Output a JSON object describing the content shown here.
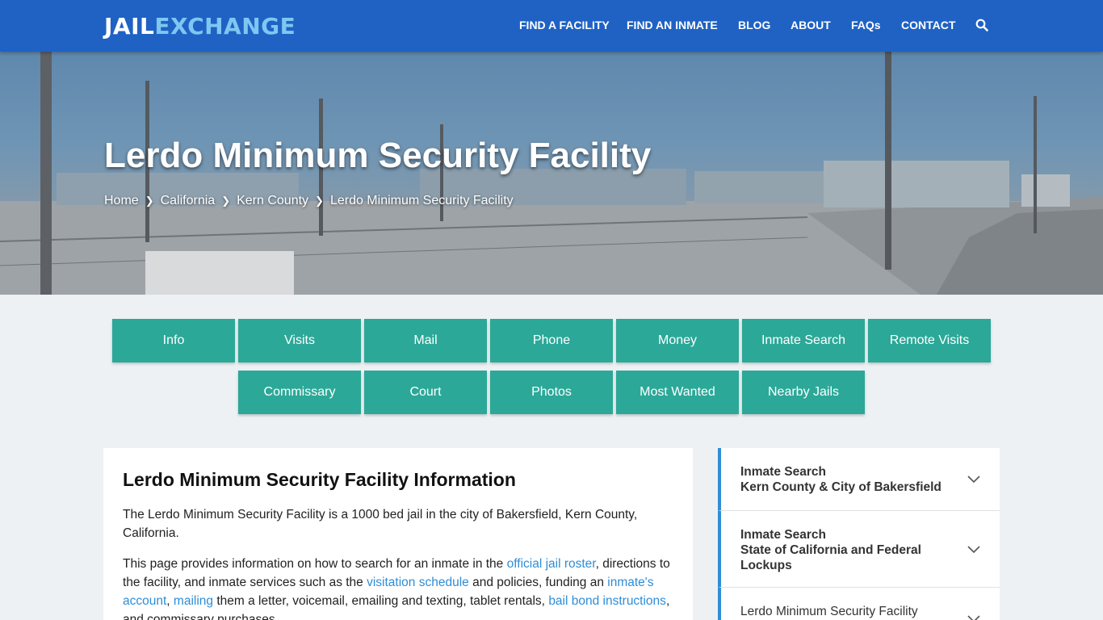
{
  "header": {
    "logo_part1": "JAIL",
    "logo_part2": "EXCHANGE",
    "nav": [
      "FIND A FACILITY",
      "FIND AN INMATE",
      "BLOG",
      "ABOUT",
      "FAQs",
      "CONTACT"
    ],
    "search_icon": "search-icon"
  },
  "hero": {
    "title": "Lerdo Minimum Security Facility",
    "breadcrumbs": [
      "Home",
      "California",
      "Kern County",
      "Lerdo Minimum Security Facility"
    ]
  },
  "service_buttons": {
    "row1": [
      "Info",
      "Visits",
      "Mail",
      "Phone",
      "Money",
      "Inmate Search",
      "Remote Visits"
    ],
    "row2": [
      "Commissary",
      "Court",
      "Photos",
      "Most Wanted",
      "Nearby Jails"
    ]
  },
  "main": {
    "heading": "Lerdo Minimum Security Facility Information",
    "para1": "The Lerdo Minimum Security Facility is a 1000 bed jail in the city of Bakersfield, Kern County, California.",
    "para2": {
      "t1": "This page provides information on how to search for an inmate in the ",
      "l1": "official jail roster",
      "t2": ", directions to the facility, and inmate services such as the ",
      "l2": "visitation schedule",
      "t3": " and policies, funding an ",
      "l3": "inmate's account",
      "t4": ", ",
      "l4": "mailing",
      "t5": " them a letter, voicemail, emailing and texting, tablet rentals, ",
      "l5": "bail bond instructions",
      "t6": ", and commissary purchases."
    }
  },
  "sidebar": {
    "items": [
      {
        "line1": "Inmate Search",
        "line2": "Kern County & City of Bakersfield"
      },
      {
        "line1": "Inmate Search",
        "line2": "State of California and Federal Lockups"
      },
      {
        "line1": "Lerdo Minimum Security Facility"
      }
    ]
  },
  "colors": {
    "header_bg": "#1f62c4",
    "logo_accent": "#7fc6f2",
    "button_bg": "#2ba898",
    "link": "#2f8dd6"
  }
}
